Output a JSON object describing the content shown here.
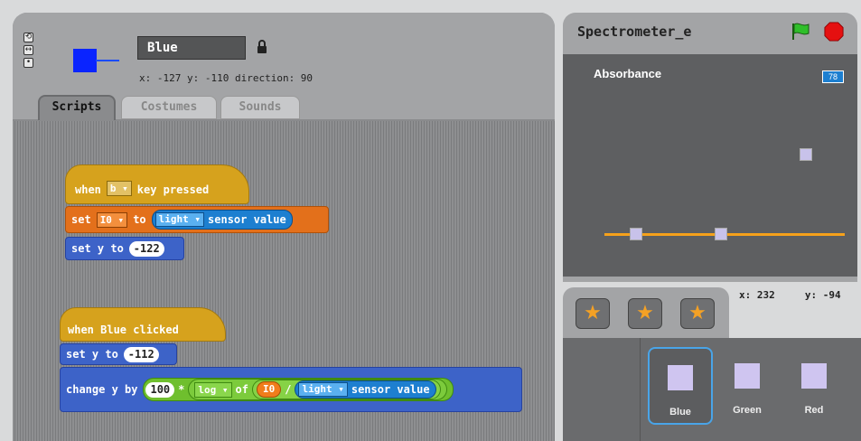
{
  "sprite": {
    "name": "Blue",
    "coords": "x: -127  y: -110  direction: 90",
    "color": "#0a24ff"
  },
  "tabs": {
    "scripts": "Scripts",
    "costumes": "Costumes",
    "sounds": "Sounds"
  },
  "script1": {
    "hat_when": "when",
    "hat_key": "b",
    "hat_suffix": "key pressed",
    "set_label": "set",
    "set_var": "I0",
    "set_to": "to",
    "sensor_name": "light",
    "sensor_suffix": "sensor value",
    "sety_label": "set y to",
    "sety_value": "-122"
  },
  "script2": {
    "hat_label": "when Blue clicked",
    "sety_label": "set y to",
    "sety_value": "-112",
    "change_label": "change y by",
    "mult_value": "100",
    "mult_op": "*",
    "func_name": "log",
    "func_of": "of",
    "var_name": "I0",
    "div_op": "/",
    "sensor_name": "light",
    "sensor_suffix": "sensor value"
  },
  "stage": {
    "project_title": "Spectrometer_e",
    "label": "Absorbance",
    "readout": "78",
    "mouse_x": "x: 232",
    "mouse_y": "y: -94",
    "line_color": "#f6a11b"
  },
  "sprites": [
    {
      "name": "Blue",
      "selected": true
    },
    {
      "name": "Green",
      "selected": false
    },
    {
      "name": "Red",
      "selected": false
    }
  ],
  "icons": {
    "green_flag": "green-flag-icon",
    "stop": "stop-icon",
    "lock": "lock-icon",
    "paint_sprite": "paint-new-sprite-icon",
    "choose_sprite": "choose-sprite-icon",
    "random_sprite": "random-sprite-icon"
  }
}
